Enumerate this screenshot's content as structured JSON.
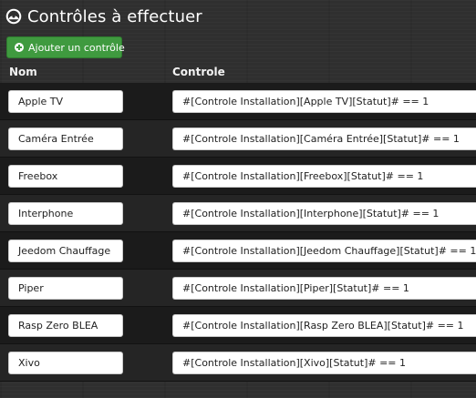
{
  "header": {
    "title": "Contrôles à effectuer",
    "icon": "dashboard-icon"
  },
  "toolbar": {
    "add_label": "Ajouter un contrôle",
    "add_icon": "plus-circle-icon",
    "add_color": "#3f9a3f"
  },
  "table": {
    "columns": [
      "Nom",
      "Controle"
    ],
    "rows": [
      {
        "name": "Apple TV",
        "control": "#[Controle Installation][Apple TV][Statut]# == 1"
      },
      {
        "name": "Caméra Entrée",
        "control": "#[Controle Installation][Caméra Entrée][Statut]# == 1"
      },
      {
        "name": "Freebox",
        "control": "#[Controle Installation][Freebox][Statut]# == 1"
      },
      {
        "name": "Interphone",
        "control": "#[Controle Installation][Interphone][Statut]# == 1"
      },
      {
        "name": "Jeedom Chauffage",
        "control": "#[Controle Installation][Jeedom Chauffage][Statut]# == 1"
      },
      {
        "name": "Piper",
        "control": "#[Controle Installation][Piper][Statut]# == 1"
      },
      {
        "name": "Rasp Zero BLEA",
        "control": "#[Controle Installation][Rasp Zero BLEA][Statut]# == 1"
      },
      {
        "name": "Xivo",
        "control": "#[Controle Installation][Xivo][Statut]# == 1"
      }
    ]
  }
}
